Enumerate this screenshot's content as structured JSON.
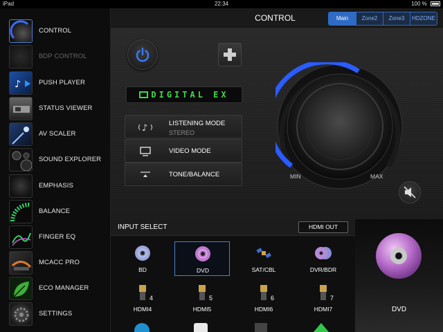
{
  "status": {
    "device": "iPad",
    "time": "22:34",
    "battery": "100 %"
  },
  "sidebar": {
    "items": [
      {
        "label": "CONTROL",
        "icon": "control-icon",
        "state": "active"
      },
      {
        "label": "BDP CONTROL",
        "icon": "bdp-control-icon",
        "state": "disabled"
      },
      {
        "label": "PUSH PLAYER",
        "icon": "push-player-icon",
        "state": "normal"
      },
      {
        "label": "STATUS VIEWER",
        "icon": "status-viewer-icon",
        "state": "normal"
      },
      {
        "label": "AV SCALER",
        "icon": "av-scaler-icon",
        "state": "normal"
      },
      {
        "label": "SOUND EXPLORER",
        "icon": "sound-explorer-icon",
        "state": "normal"
      },
      {
        "label": "EMPHASIS",
        "icon": "emphasis-icon",
        "state": "normal"
      },
      {
        "label": "BALANCE",
        "icon": "balance-icon",
        "state": "normal"
      },
      {
        "label": "FINGER EQ",
        "icon": "finger-eq-icon",
        "state": "normal"
      },
      {
        "label": "MCACC PRO",
        "icon": "mcacc-pro-icon",
        "state": "normal"
      },
      {
        "label": "ECO MANAGER",
        "icon": "eco-manager-icon",
        "state": "normal"
      },
      {
        "label": "SETTINGS",
        "icon": "settings-icon",
        "state": "normal"
      }
    ]
  },
  "header": {
    "title": "CONTROL",
    "zones": [
      "Main",
      "Zone2",
      "Zone3",
      "HDZONE"
    ],
    "selected_zone": "Main"
  },
  "controls": {
    "digital_display": "DIGITAL EX",
    "listening_mode": {
      "label": "LISTENING MODE",
      "value": "STEREO"
    },
    "video_mode": {
      "label": "VIDEO MODE"
    },
    "tone_balance": {
      "label": "TONE/BALANCE"
    },
    "volume": {
      "min_label": "MIN",
      "max_label": "MAX"
    }
  },
  "input_select": {
    "title": "INPUT SELECT",
    "hdmi_out_label": "HDMI OUT",
    "sources": [
      {
        "label": "BD",
        "icon": "disc-icon"
      },
      {
        "label": "DVD",
        "icon": "disc-icon",
        "selected": true
      },
      {
        "label": "SAT/CBL",
        "icon": "satellite-icon"
      },
      {
        "label": "DVR/BDR",
        "icon": "discs-icon"
      },
      {
        "label": "HDMI4",
        "icon": "hdmi-plug-icon",
        "number": "4"
      },
      {
        "label": "HDMI5",
        "icon": "hdmi-plug-icon",
        "number": "5"
      },
      {
        "label": "HDMI6",
        "icon": "hdmi-plug-icon",
        "number": "6"
      },
      {
        "label": "HDMI7",
        "icon": "hdmi-plug-icon",
        "number": "7"
      }
    ]
  },
  "preview": {
    "label": "DVD"
  },
  "colors": {
    "accent_blue": "#2e6bc4",
    "display_green": "#3ed94a",
    "volume_arc": "#2a5cff"
  }
}
